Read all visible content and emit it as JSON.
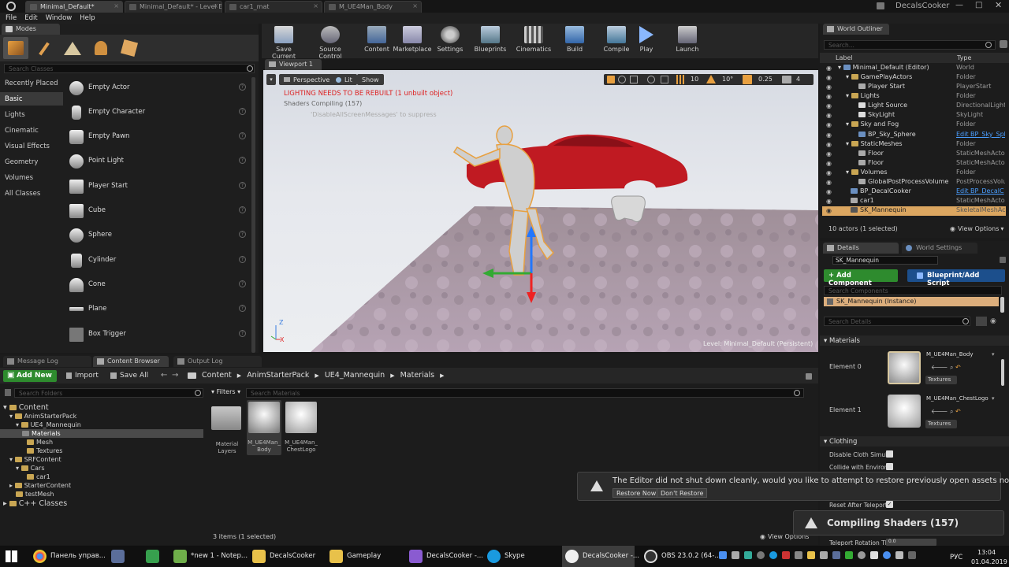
{
  "title_tabs": [
    "Minimal_Default*",
    "Minimal_Default* - Level E",
    "car1_mat",
    "M_UE4Man_Body"
  ],
  "app_name": "DecalsCooker",
  "menu": [
    "File",
    "Edit",
    "Window",
    "Help"
  ],
  "modes": {
    "tab": "Modes",
    "search_placeholder": "Search Classes",
    "categories": [
      "Recently Placed",
      "Basic",
      "Lights",
      "Cinematic",
      "Visual Effects",
      "Geometry",
      "Volumes",
      "All Classes"
    ],
    "items": [
      "Empty Actor",
      "Empty Character",
      "Empty Pawn",
      "Point Light",
      "Player Start",
      "Cube",
      "Sphere",
      "Cylinder",
      "Cone",
      "Plane",
      "Box Trigger"
    ]
  },
  "toolbar": [
    "Save Current",
    "Source Control",
    "Content",
    "Marketplace",
    "Settings",
    "Blueprints",
    "Cinematics",
    "Build",
    "Compile",
    "Play",
    "Launch"
  ],
  "viewport": {
    "tab": "Viewport 1",
    "perspective": "Perspective",
    "lit": "Lit",
    "show": "Show",
    "snap_values": [
      "10",
      "10°",
      "0.25",
      "4"
    ],
    "warn1": "LIGHTING NEEDS TO BE REBUILT (1 unbuilt object)",
    "warn2": "Shaders Compiling (157)",
    "warn3": "'DisableAllScreenMessages' to suppress",
    "level": "Level:  Minimal_Default (Persistent)",
    "axis_z": "Z",
    "axis_x": "X"
  },
  "outliner": {
    "tab": "World Outliner",
    "search_placeholder": "Search...",
    "col_label": "Label",
    "col_type": "Type",
    "rows": [
      {
        "label": "Minimal_Default (Editor)",
        "type": "World"
      },
      {
        "label": "GamePlayActors",
        "type": "Folder"
      },
      {
        "label": "Player Start",
        "type": "PlayerStart"
      },
      {
        "label": "Lights",
        "type": "Folder"
      },
      {
        "label": "Light Source",
        "type": "DirectionalLight"
      },
      {
        "label": "SkyLight",
        "type": "SkyLight"
      },
      {
        "label": "Sky and Fog",
        "type": "Folder"
      },
      {
        "label": "BP_Sky_Sphere",
        "type": "Edit BP_Sky_Sph"
      },
      {
        "label": "StaticMeshes",
        "type": "Folder"
      },
      {
        "label": "Floor",
        "type": "StaticMeshActor"
      },
      {
        "label": "Floor",
        "type": "StaticMeshActor"
      },
      {
        "label": "Volumes",
        "type": "Folder"
      },
      {
        "label": "GlobalPostProcessVolume",
        "type": "PostProcessVolu"
      },
      {
        "label": "BP_DecalCooker",
        "type": "Edit BP_DecalC"
      },
      {
        "label": "car1",
        "type": "StaticMeshActor"
      },
      {
        "label": "SK_Mannequin",
        "type": "SkeletalMeshActo"
      }
    ],
    "status": "10 actors (1 selected)",
    "view_options": "View Options"
  },
  "details": {
    "tab": "Details",
    "tab2": "World Settings",
    "name_value": "SK_Mannequin",
    "add_component": "+ Add Component",
    "blueprint_script": "Blueprint/Add Script",
    "search_components": "Search Components",
    "instance": "SK_Mannequin (Instance)",
    "search_details": "Search Details",
    "materials_section": "Materials",
    "element0": "Element 0",
    "element1": "Element 1",
    "mat0": "M_UE4Man_Body",
    "mat1": "M_UE4Man_ChestLogo",
    "textures": "Textures",
    "clothing_section": "Clothing",
    "disable_cloth": "Disable Cloth Simula",
    "collide": "Collide with Environ",
    "reset_after": "Reset After Teleport",
    "teleport_rotation": "Teleport Rotation Th",
    "teleport_value": "0.0"
  },
  "bottom": {
    "tabs": [
      "Message Log",
      "Content Browser",
      "Output Log"
    ],
    "add_new": "Add New",
    "import": "Import",
    "save_all": "Save All",
    "path": [
      "Content",
      "AnimStarterPack",
      "UE4_Mannequin",
      "Materials"
    ],
    "search_folders": "Search Folders",
    "filters": "Filters",
    "search_materials": "Search Materials",
    "tree": [
      "Content",
      "AnimStarterPack",
      "UE4_Mannequin",
      "Materials",
      "Mesh",
      "Textures",
      "SRFContent",
      "Cars",
      "car1",
      "StarterContent",
      "testMesh",
      "C++ Classes"
    ],
    "assets": [
      {
        "name": "Material Layers"
      },
      {
        "name": "M_UE4Man_Body"
      },
      {
        "name": "M_UE4Man_ChestLogo"
      }
    ],
    "status": "3 items (1 selected)",
    "view_options": "View Options"
  },
  "notification": {
    "text": "The Editor did not shut down cleanly, would you like to attempt to restore previously open assets now?",
    "restore": "Restore Now",
    "dont": "Don't Restore"
  },
  "compiling": "Compiling Shaders (157)",
  "taskbar": {
    "items": [
      "Панель управ...",
      "",
      "",
      "*new 1 - Notep...",
      "DecalsCooker",
      "Gameplay",
      "DecalsCooker -...",
      "Skype",
      "DecalsCooker -...",
      "OBS 23.0.2 (64-..."
    ],
    "lang": "РУС",
    "time": "13:04",
    "date": "01.04.2019"
  }
}
